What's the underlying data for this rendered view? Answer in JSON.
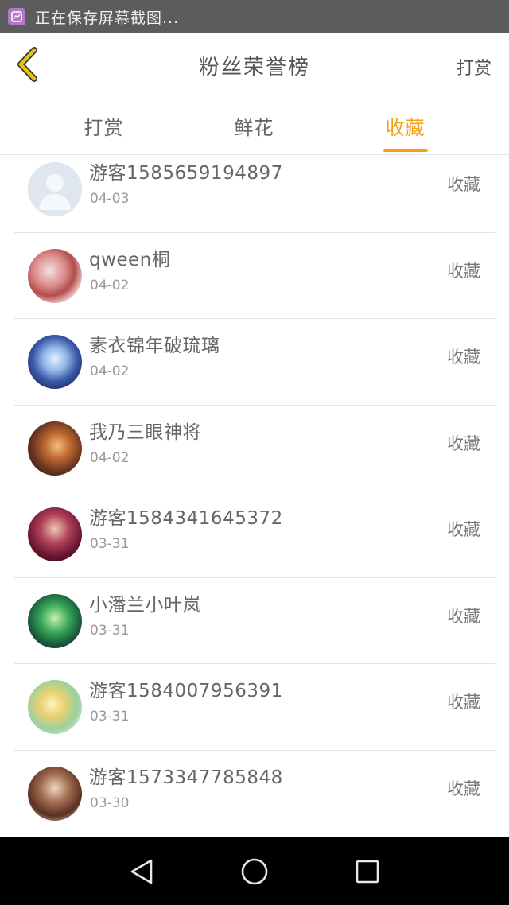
{
  "status_bar": {
    "text": "正在保存屏幕截图..."
  },
  "header": {
    "title": "粉丝荣誉榜",
    "action": "打赏"
  },
  "tabs": [
    {
      "label": "打赏",
      "active": false
    },
    {
      "label": "鲜花",
      "active": false
    },
    {
      "label": "收藏",
      "active": true
    }
  ],
  "list": [
    {
      "name": "游客1585659194897",
      "date": "04-03",
      "action": "收藏"
    },
    {
      "name": "qween桐",
      "date": "04-02",
      "action": "收藏"
    },
    {
      "name": "素衣锦年破琉璃",
      "date": "04-02",
      "action": "收藏"
    },
    {
      "name": "我乃三眼神将",
      "date": "04-02",
      "action": "收藏"
    },
    {
      "name": "游客1584341645372",
      "date": "03-31",
      "action": "收藏"
    },
    {
      "name": "小潘兰小叶岚",
      "date": "03-31",
      "action": "收藏"
    },
    {
      "name": "游客1584007956391",
      "date": "03-31",
      "action": "收藏"
    },
    {
      "name": "游客1573347785848",
      "date": "03-30",
      "action": "收藏"
    }
  ],
  "colors": {
    "accent": "#f5a01a",
    "back_arrow": "#e6c11a"
  }
}
